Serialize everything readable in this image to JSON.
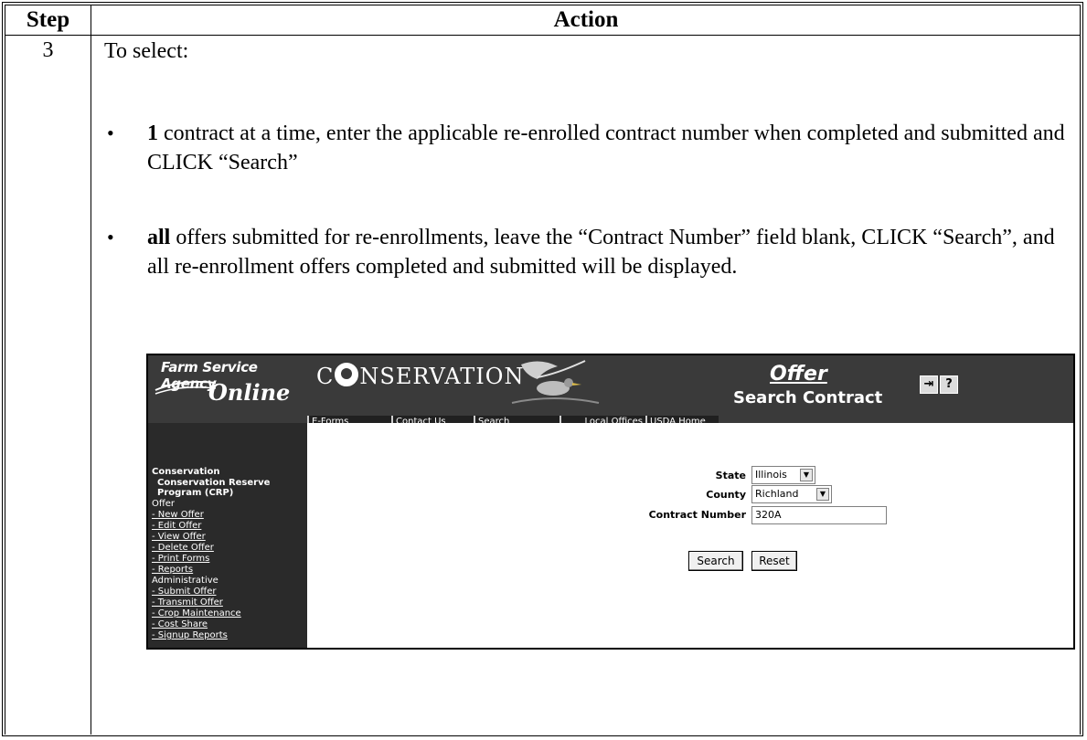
{
  "table": {
    "header_step": "Step",
    "header_action": "Action",
    "step_number": "3"
  },
  "content": {
    "intro": "To select:",
    "bullet1_bold": "1",
    "bullet1_text": " contract at a time, enter the applicable re-enrolled contract number when completed and submitted and CLICK “Search”",
    "bullet2_bold": "all",
    "bullet2_text": " offers submitted for re-enrollments, leave the “Contract Number” field blank, CLICK “Search”, and all re-enrollment offers completed and submitted will be displayed.",
    "bullet_glyph": "•"
  },
  "screenshot": {
    "logo_line1": "Farm Service Agency",
    "logo_line2": "Online",
    "brand_prefix": "C",
    "brand_suffix": "NSERVATION",
    "page_title": "Offer",
    "page_subtitle": "Search Contract",
    "toolbar_icons": [
      "exit-icon",
      "help-icon"
    ],
    "toolbar_icon_glyphs": [
      "⇥",
      "?"
    ],
    "nav": [
      "E-Forms",
      "Contact Us",
      "Search",
      "Local Offices",
      "USDA Home"
    ],
    "sidebar": {
      "section": "Conservation",
      "program_line1": "Conservation Reserve",
      "program_line2": "Program (CRP)",
      "group1": "Offer",
      "group1_items": [
        "- New Offer",
        "- Edit Offer",
        "- View Offer",
        "- Delete Offer",
        "- Print Forms",
        "- Reports"
      ],
      "group2": "Administrative",
      "group2_items": [
        "- Submit Offer",
        "- Transmit Offer",
        "- Crop Maintenance",
        "- Cost Share",
        "- Signup Reports"
      ]
    },
    "form": {
      "state_label": "State",
      "state_value": "Illinois",
      "county_label": "County",
      "county_value": "Richland",
      "contract_label": "Contract Number",
      "contract_value": "320A",
      "search_button": "Search",
      "reset_button": "Reset"
    },
    "colors": {
      "banner": "#3a3a3a",
      "sidebar": "#2a2a2a",
      "main": "#ffffff"
    }
  }
}
